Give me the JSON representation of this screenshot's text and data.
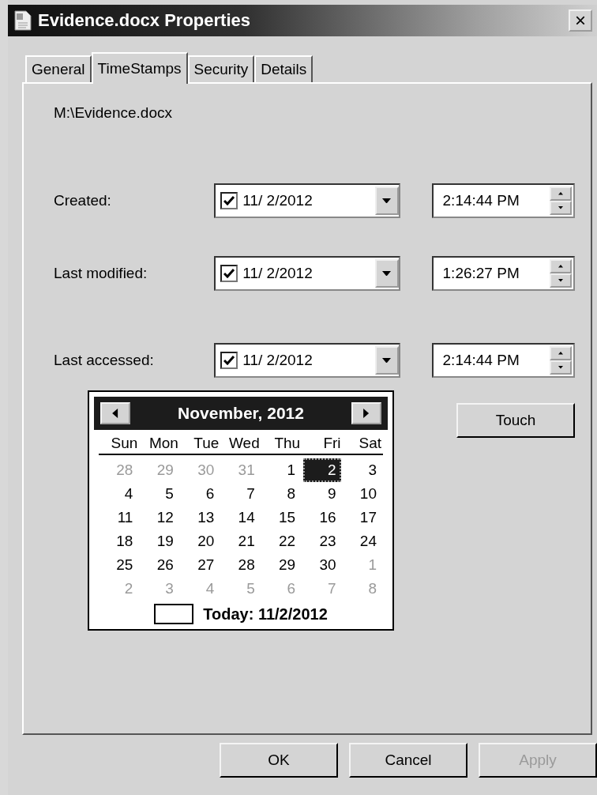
{
  "window": {
    "title": "Evidence.docx Properties",
    "close": "×"
  },
  "tabs": [
    {
      "label": "General",
      "selected": false
    },
    {
      "label": "TimeStamps",
      "selected": true
    },
    {
      "label": "Security",
      "selected": false
    },
    {
      "label": "Details",
      "selected": false
    }
  ],
  "path": "M:\\Evidence.docx",
  "rows": [
    {
      "label": "Created:",
      "checked": true,
      "date": "11/ 2/2012",
      "time": "2:14:44 PM"
    },
    {
      "label": "Last modified:",
      "checked": true,
      "date": "11/ 2/2012",
      "time": "1:26:27 PM"
    },
    {
      "label": "Last accessed:",
      "checked": true,
      "date": "11/ 2/2012",
      "time": "2:14:44 PM"
    }
  ],
  "calendar": {
    "title": "November, 2012",
    "weekdays": [
      "Sun",
      "Mon",
      "Tue",
      "Wed",
      "Thu",
      "Fri",
      "Sat"
    ],
    "weeks": [
      [
        {
          "label": "28",
          "other_month": true,
          "selected": false
        },
        {
          "label": "29",
          "other_month": true,
          "selected": false
        },
        {
          "label": "30",
          "other_month": true,
          "selected": false
        },
        {
          "label": "31",
          "other_month": true,
          "selected": false
        },
        {
          "label": "1",
          "other_month": false,
          "selected": false
        },
        {
          "label": "2",
          "other_month": false,
          "selected": true
        },
        {
          "label": "3",
          "other_month": false,
          "selected": false
        }
      ],
      [
        {
          "label": "4",
          "other_month": false,
          "selected": false
        },
        {
          "label": "5",
          "other_month": false,
          "selected": false
        },
        {
          "label": "6",
          "other_month": false,
          "selected": false
        },
        {
          "label": "7",
          "other_month": false,
          "selected": false
        },
        {
          "label": "8",
          "other_month": false,
          "selected": false
        },
        {
          "label": "9",
          "other_month": false,
          "selected": false
        },
        {
          "label": "10",
          "other_month": false,
          "selected": false
        }
      ],
      [
        {
          "label": "11",
          "other_month": false,
          "selected": false
        },
        {
          "label": "12",
          "other_month": false,
          "selected": false
        },
        {
          "label": "13",
          "other_month": false,
          "selected": false
        },
        {
          "label": "14",
          "other_month": false,
          "selected": false
        },
        {
          "label": "15",
          "other_month": false,
          "selected": false
        },
        {
          "label": "16",
          "other_month": false,
          "selected": false
        },
        {
          "label": "17",
          "other_month": false,
          "selected": false
        }
      ],
      [
        {
          "label": "18",
          "other_month": false,
          "selected": false
        },
        {
          "label": "19",
          "other_month": false,
          "selected": false
        },
        {
          "label": "20",
          "other_month": false,
          "selected": false
        },
        {
          "label": "21",
          "other_month": false,
          "selected": false
        },
        {
          "label": "22",
          "other_month": false,
          "selected": false
        },
        {
          "label": "23",
          "other_month": false,
          "selected": false
        },
        {
          "label": "24",
          "other_month": false,
          "selected": false
        }
      ],
      [
        {
          "label": "25",
          "other_month": false,
          "selected": false
        },
        {
          "label": "26",
          "other_month": false,
          "selected": false
        },
        {
          "label": "27",
          "other_month": false,
          "selected": false
        },
        {
          "label": "28",
          "other_month": false,
          "selected": false
        },
        {
          "label": "29",
          "other_month": false,
          "selected": false
        },
        {
          "label": "30",
          "other_month": false,
          "selected": false
        },
        {
          "label": "1",
          "other_month": true,
          "selected": false
        }
      ],
      [
        {
          "label": "2",
          "other_month": true,
          "selected": false
        },
        {
          "label": "3",
          "other_month": true,
          "selected": false
        },
        {
          "label": "4",
          "other_month": true,
          "selected": false
        },
        {
          "label": "5",
          "other_month": true,
          "selected": false
        },
        {
          "label": "6",
          "other_month": true,
          "selected": false
        },
        {
          "label": "7",
          "other_month": true,
          "selected": false
        },
        {
          "label": "8",
          "other_month": true,
          "selected": false
        }
      ]
    ],
    "today": "Today: 11/2/2012"
  },
  "touch_button": "Touch",
  "buttons": [
    {
      "label": "OK",
      "disabled": false
    },
    {
      "label": "Cancel",
      "disabled": false
    },
    {
      "label": "Apply",
      "disabled": true
    }
  ]
}
